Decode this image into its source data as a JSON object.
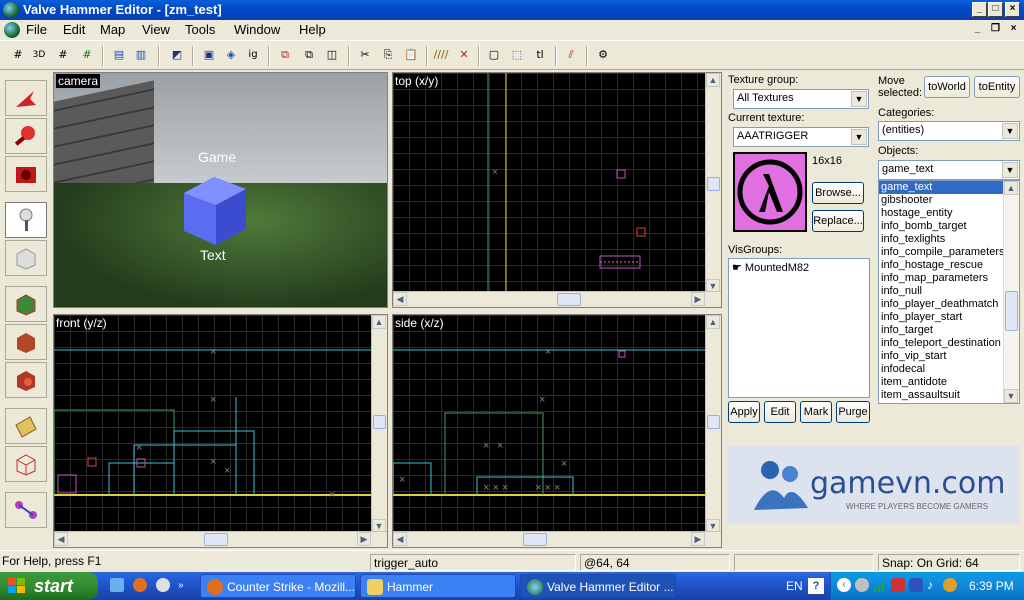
{
  "window": {
    "title": "Valve Hammer Editor - [zm_test]",
    "icon": "hammer-globe-icon"
  },
  "menu": [
    "File",
    "Edit",
    "Map",
    "View",
    "Tools",
    "Window",
    "Help"
  ],
  "viewports": {
    "camera": {
      "label": "camera",
      "entity_text_1": "Game",
      "entity_text_2": "Text"
    },
    "top": {
      "label": "top (x/y)"
    },
    "front": {
      "label": "front (y/z)"
    },
    "side": {
      "label": "side (x/z)"
    }
  },
  "texture_panel": {
    "texture_group_label": "Texture group:",
    "texture_group_value": "All Textures",
    "current_texture_label": "Current texture:",
    "current_texture_value": "AAATRIGGER",
    "texture_size": "16x16",
    "browse_label": "Browse...",
    "replace_label": "Replace..."
  },
  "visgroups": {
    "label": "VisGroups:",
    "items": [
      "MountedM82"
    ],
    "apply": "Apply",
    "edit": "Edit",
    "mark": "Mark",
    "purge": "Purge"
  },
  "objects_panel": {
    "move_selected_label_1": "Move",
    "move_selected_label_2": "selected:",
    "to_world": "toWorld",
    "to_entity": "toEntity",
    "categories_label": "Categories:",
    "categories_value": "(entities)",
    "objects_label": "Objects:",
    "objects_value": "game_text",
    "list": [
      "game_text",
      "gibshooter",
      "hostage_entity",
      "info_bomb_target",
      "info_texlights",
      "info_compile_parameters",
      "info_hostage_rescue",
      "info_map_parameters",
      "info_null",
      "info_player_deathmatch",
      "info_player_start",
      "info_target",
      "info_teleport_destination",
      "info_vip_start",
      "infodecal",
      "item_antidote",
      "item_assaultsuit"
    ]
  },
  "logo": {
    "brand": "gamevn.com",
    "tagline": "WHERE PLAYERS BECOME GAMERS"
  },
  "status": {
    "help": "For Help, press F1",
    "selection": "trigger_auto",
    "coords": "@64, 64",
    "snap": "Snap: On Grid: 64"
  },
  "taskbar": {
    "start": "start",
    "tasks": [
      "Counter Strike - Mozill...",
      "Hammer",
      "Valve Hammer Editor ..."
    ],
    "lang": "EN",
    "clock": "6:39 PM"
  },
  "colors": {
    "accent": "#316AC5",
    "viewport_bg": "#000000",
    "brush_yellow": "#d8d040",
    "brush_cyan": "#40c0d0"
  }
}
